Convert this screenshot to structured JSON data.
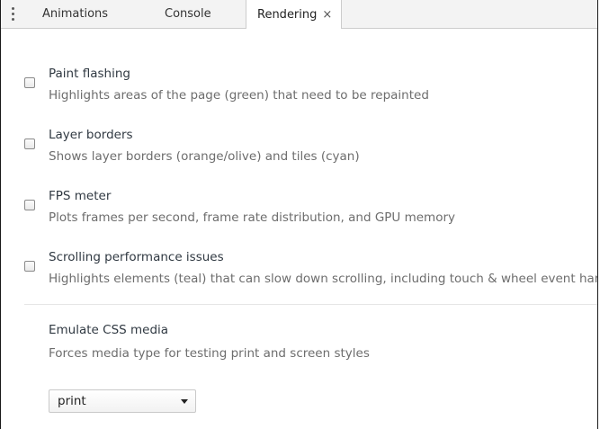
{
  "tabbar": {
    "menu_icon": "vertical-dots-icon",
    "tabs": [
      {
        "label": "Animations"
      },
      {
        "label": "Console"
      },
      {
        "label": "Rendering",
        "active": true,
        "close": "×"
      }
    ]
  },
  "options": [
    {
      "title": "Paint flashing",
      "description": "Highlights areas of the page (green) that need to be repainted",
      "checked": false
    },
    {
      "title": "Layer borders",
      "description": "Shows layer borders (orange/olive) and tiles (cyan)",
      "checked": false
    },
    {
      "title": "FPS meter",
      "description": "Plots frames per second, frame rate distribution, and GPU memory",
      "checked": false
    },
    {
      "title": "Scrolling performance issues",
      "description": "Highlights elements (teal) that can slow down scrolling, including touch & wheel event handlers and other main-thread scrolling situations.",
      "checked": false
    }
  ],
  "emulate_media": {
    "title": "Emulate CSS media",
    "description": "Forces media type for testing print and screen styles",
    "selected": "print"
  }
}
